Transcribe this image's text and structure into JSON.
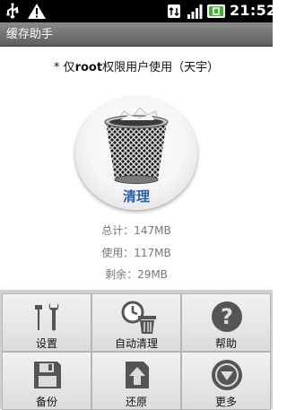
{
  "status_bar": {
    "time": "21:52"
  },
  "title_bar": {
    "title": "缓存助手"
  },
  "notice": {
    "prefix": "* 仅",
    "bold": "root",
    "suffix": "权限用户使用（天宇）"
  },
  "clean": {
    "label": "清理"
  },
  "stats": {
    "total": "总计：147MB",
    "used": "使用：117MB",
    "free": "剩余：29MB"
  },
  "menu": {
    "settings": "设置",
    "auto_clean": "自动清理",
    "help": "帮助",
    "backup": "备份",
    "restore": "还原",
    "more": "更多"
  },
  "colors": {
    "accent": "#2a5fa8",
    "title_bar": "#6e6e6e"
  }
}
